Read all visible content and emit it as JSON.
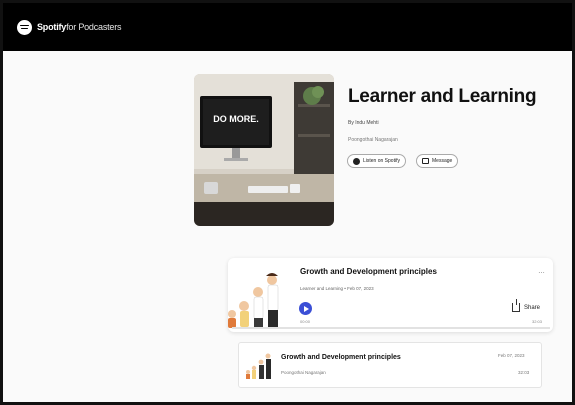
{
  "header": {
    "brand_bold": "Spotify",
    "brand_light": "for Podcasters"
  },
  "show": {
    "title": "Learner and Learning",
    "author": "By Indu Mehti",
    "subtitle": "Poongothai Nagarajan",
    "cover_text": "DO MORE.",
    "listen_label": "Listen on Spotify",
    "message_label": "Message"
  },
  "featured_episode": {
    "title": "Growth and Development principles",
    "meta": "Learner and Learning • Feb 07, 2023",
    "time_start": "00:00",
    "time_end": "32:03",
    "share_label": "Share",
    "more": "…",
    "progress": 0
  },
  "episode_list": [
    {
      "title": "Growth and Development principles",
      "subtitle": "Poongothai Nagarajan",
      "date": "Feb 07, 2023",
      "duration": "32:03"
    }
  ],
  "colors": {
    "header_bg": "#000000",
    "play_button": "#3b4fd6"
  },
  "icons": [
    "spotify-logo-icon",
    "spotify-icon",
    "message-icon",
    "play-icon",
    "share-icon",
    "more-icon"
  ]
}
